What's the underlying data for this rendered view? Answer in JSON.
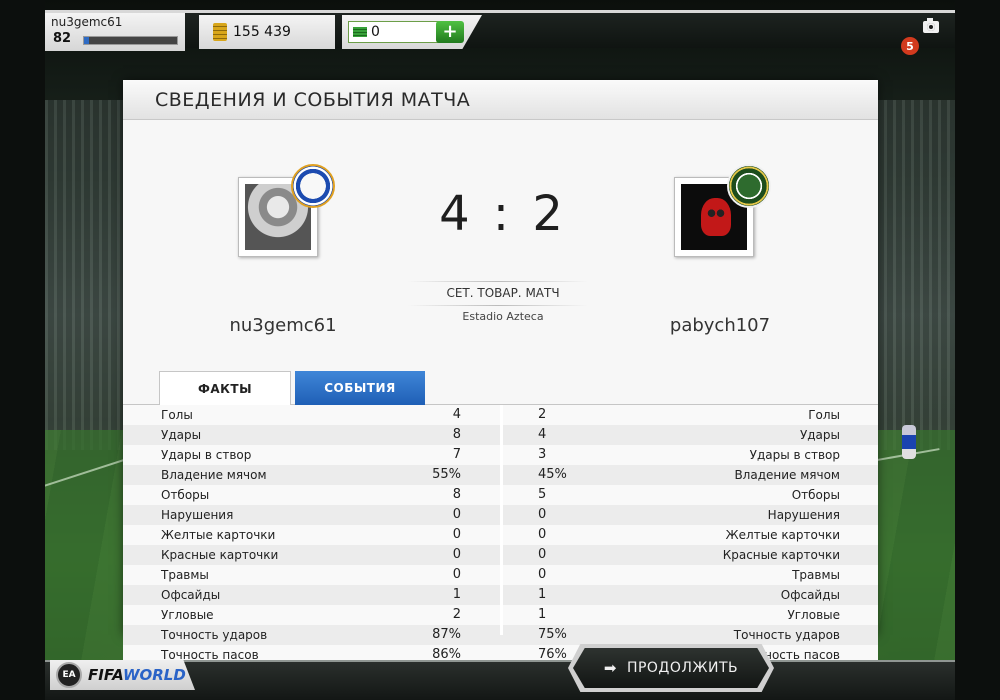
{
  "topbar": {
    "username": "nu3gemc61",
    "level": "82",
    "xp_progress": 0.05,
    "coins": "155 439",
    "points": "0",
    "add_button": "+",
    "notification_count": "5"
  },
  "panel": {
    "title": "СВЕДЕНИЯ И СОБЫТИЯ МАТЧА"
  },
  "match": {
    "score": "4 : 2",
    "match_type": "СЕТ. ТОВАР. МАТЧ",
    "venue": "Estadio Azteca",
    "home_player": "nu3gemc61",
    "away_player": "pabych107"
  },
  "tabs": {
    "facts": "ФАКТЫ",
    "events": "СОБЫТИЯ"
  },
  "stats": [
    {
      "label": "Голы",
      "home": "4",
      "away": "2"
    },
    {
      "label": "Удары",
      "home": "8",
      "away": "4"
    },
    {
      "label": "Удары в створ",
      "home": "7",
      "away": "3"
    },
    {
      "label": "Владение мячом",
      "home": "55%",
      "away": "45%"
    },
    {
      "label": "Отборы",
      "home": "8",
      "away": "5"
    },
    {
      "label": "Нарушения",
      "home": "0",
      "away": "0"
    },
    {
      "label": "Желтые карточки",
      "home": "0",
      "away": "0"
    },
    {
      "label": "Красные карточки",
      "home": "0",
      "away": "0"
    },
    {
      "label": "Травмы",
      "home": "0",
      "away": "0"
    },
    {
      "label": "Офсайды",
      "home": "1",
      "away": "1"
    },
    {
      "label": "Угловые",
      "home": "2",
      "away": "1"
    },
    {
      "label": "Точность ударов",
      "home": "87%",
      "away": "75%"
    },
    {
      "label": "Точность пасов",
      "home": "86%",
      "away": "76%"
    }
  ],
  "footer": {
    "continue_label": "ПРОДОЛЖИТЬ",
    "logo_fifa": "FIFA",
    "logo_world": "WORLD",
    "logo_ea": "EA"
  },
  "colors": {
    "accent_tab": "#2f74c8",
    "add_button": "#3aa535",
    "badge": "#d23a1e"
  }
}
